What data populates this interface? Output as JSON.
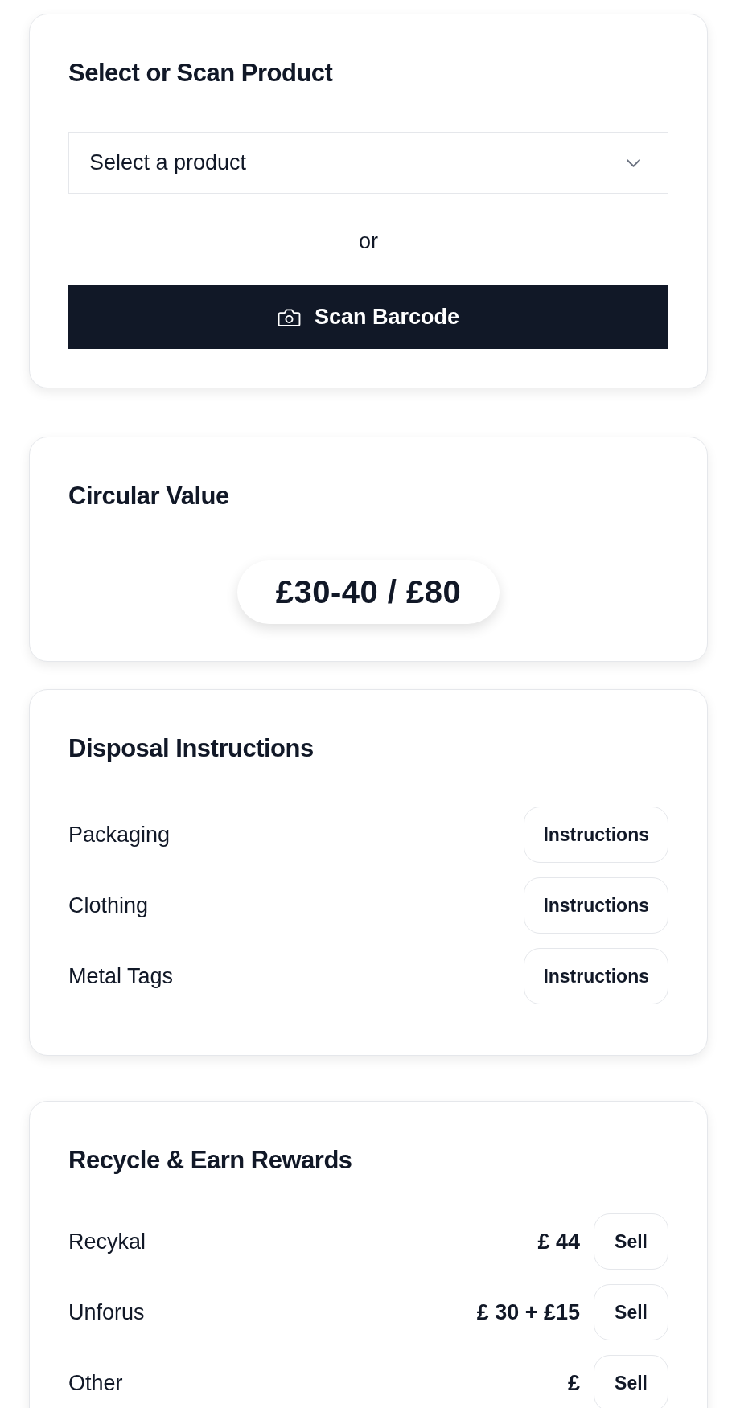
{
  "product_card": {
    "title": "Select or Scan Product",
    "select": {
      "placeholder": "Select a product"
    },
    "separator": "or",
    "scan_button": "Scan Barcode"
  },
  "value_card": {
    "title": "Circular Value",
    "value": "£30-40 / £80"
  },
  "disposal_card": {
    "title": "Disposal Instructions",
    "items": [
      {
        "label": "Packaging",
        "button": "Instructions"
      },
      {
        "label": "Clothing",
        "button": "Instructions"
      },
      {
        "label": "Metal Tags",
        "button": "Instructions"
      }
    ]
  },
  "rewards_card": {
    "title": "Recycle & Earn Rewards",
    "items": [
      {
        "name": "Recykal",
        "price": "£ 44",
        "button": "Sell"
      },
      {
        "name": "Unforus",
        "price": "£ 30 + £15",
        "button": "Sell"
      },
      {
        "name": "Other",
        "price": "£",
        "button": "Sell"
      }
    ]
  }
}
